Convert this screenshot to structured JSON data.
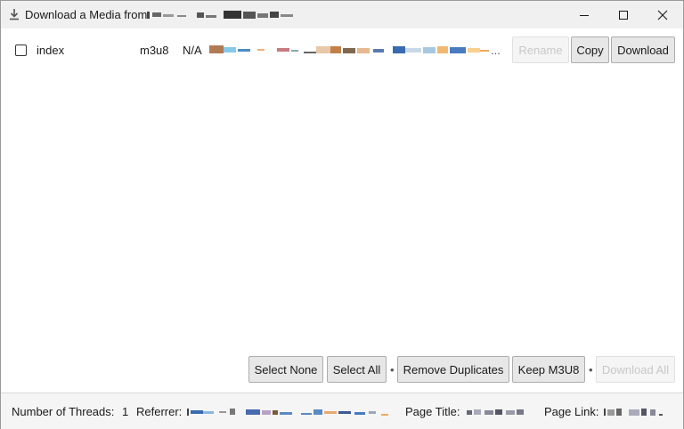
{
  "window": {
    "title": "Download a Media from",
    "controls": {
      "minimize": "─",
      "maximize": "☐",
      "close": "✕"
    }
  },
  "items": [
    {
      "name": "index",
      "type": "m3u8",
      "size": "N/A",
      "url_truncation": "..."
    }
  ],
  "row_actions": {
    "rename": "Rename",
    "copy": "Copy",
    "download": "Download"
  },
  "bulk_actions": {
    "select_none": "Select None",
    "select_all": "Select All",
    "separator": "•",
    "remove_duplicates": "Remove Duplicates",
    "keep_m3u8": "Keep M3U8",
    "download_all": "Download All"
  },
  "footer": {
    "threads_label": "Number of Threads:",
    "threads_value": "1",
    "referrer_label": "Referrer:",
    "page_title_label": "Page Title:",
    "page_link_label": "Page Link:"
  },
  "colors": {
    "button_bg": "#e7e7e7",
    "button_border": "#adadad",
    "disabled_text": "#c8c8c8",
    "titlebar_bg": "#f0f0f0"
  }
}
